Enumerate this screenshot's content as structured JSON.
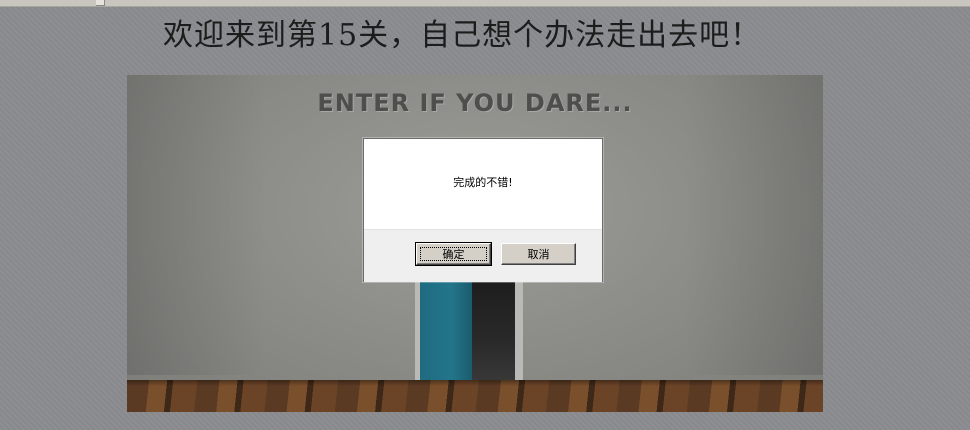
{
  "page": {
    "title": "欢迎来到第15关，自己想个办法走出去吧！"
  },
  "scene": {
    "caption": "ENTER IF YOU DARE...",
    "door_color": "#23758b"
  },
  "dialog": {
    "message": "完成的不错!",
    "ok_label": "确定",
    "cancel_label": "取消"
  },
  "colors": {
    "page_background": "#8b8c8f",
    "dialog_footer": "#efefef",
    "button_face": "#d4d0c8"
  }
}
